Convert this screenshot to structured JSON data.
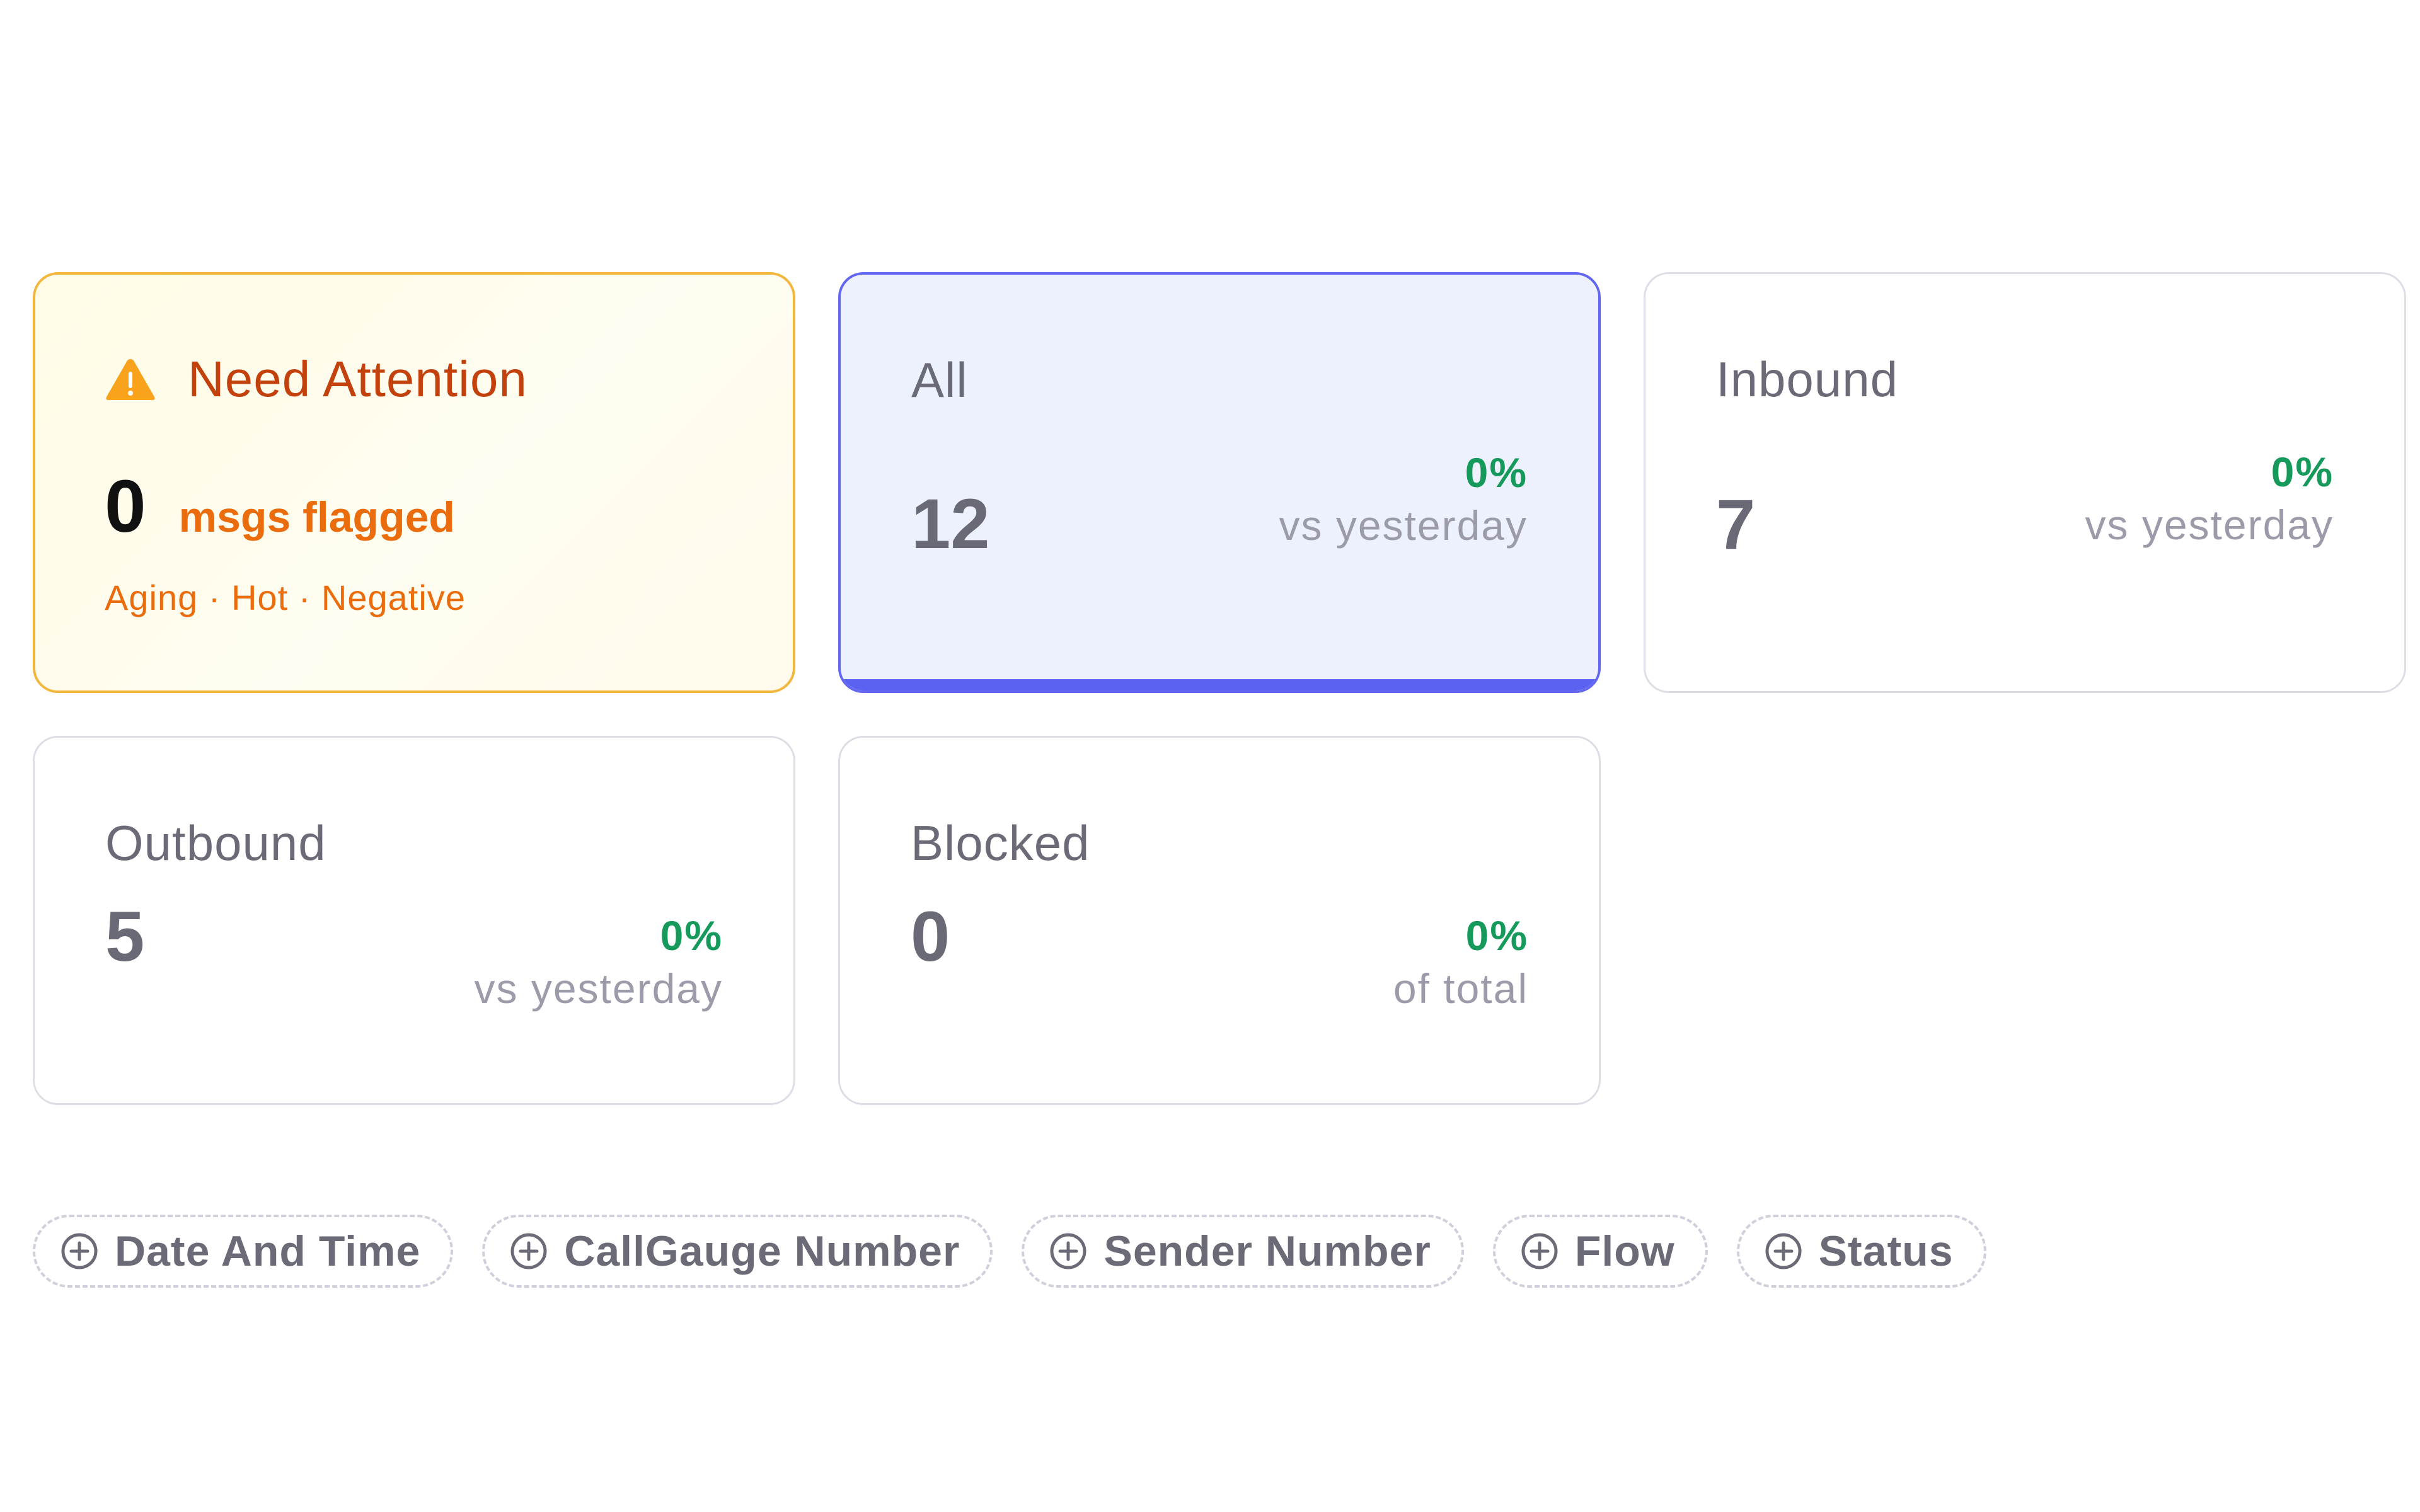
{
  "colors": {
    "attention_border": "#f3b63c",
    "attention_text": "#c2410c",
    "selected_border": "#6366f1",
    "selected_bg": "#edf1fe",
    "positive_delta": "#159a5c"
  },
  "attention": {
    "icon": "warning-triangle-icon",
    "title": "Need Attention",
    "count": "0",
    "count_label": "msgs flagged",
    "tags": "Aging · Hot · Negative"
  },
  "stats": [
    {
      "id": "all",
      "title": "All",
      "value": "12",
      "delta": "0%",
      "delta_label": "vs yesterday",
      "selected": true
    },
    {
      "id": "inbound",
      "title": "Inbound",
      "value": "7",
      "delta": "0%",
      "delta_label": "vs yesterday",
      "selected": false
    },
    {
      "id": "outbound",
      "title": "Outbound",
      "value": "5",
      "delta": "0%",
      "delta_label": "vs yesterday",
      "selected": false
    },
    {
      "id": "blocked",
      "title": "Blocked",
      "value": "0",
      "delta": "0%",
      "delta_label": "of total",
      "selected": false
    }
  ],
  "filters": [
    {
      "label": "Date And Time",
      "icon": "plus-circle-icon"
    },
    {
      "label": "CallGauge Number",
      "icon": "plus-circle-icon"
    },
    {
      "label": "Sender Number",
      "icon": "plus-circle-icon"
    },
    {
      "label": "Flow",
      "icon": "plus-circle-icon"
    },
    {
      "label": "Status",
      "icon": "plus-circle-icon"
    }
  ]
}
